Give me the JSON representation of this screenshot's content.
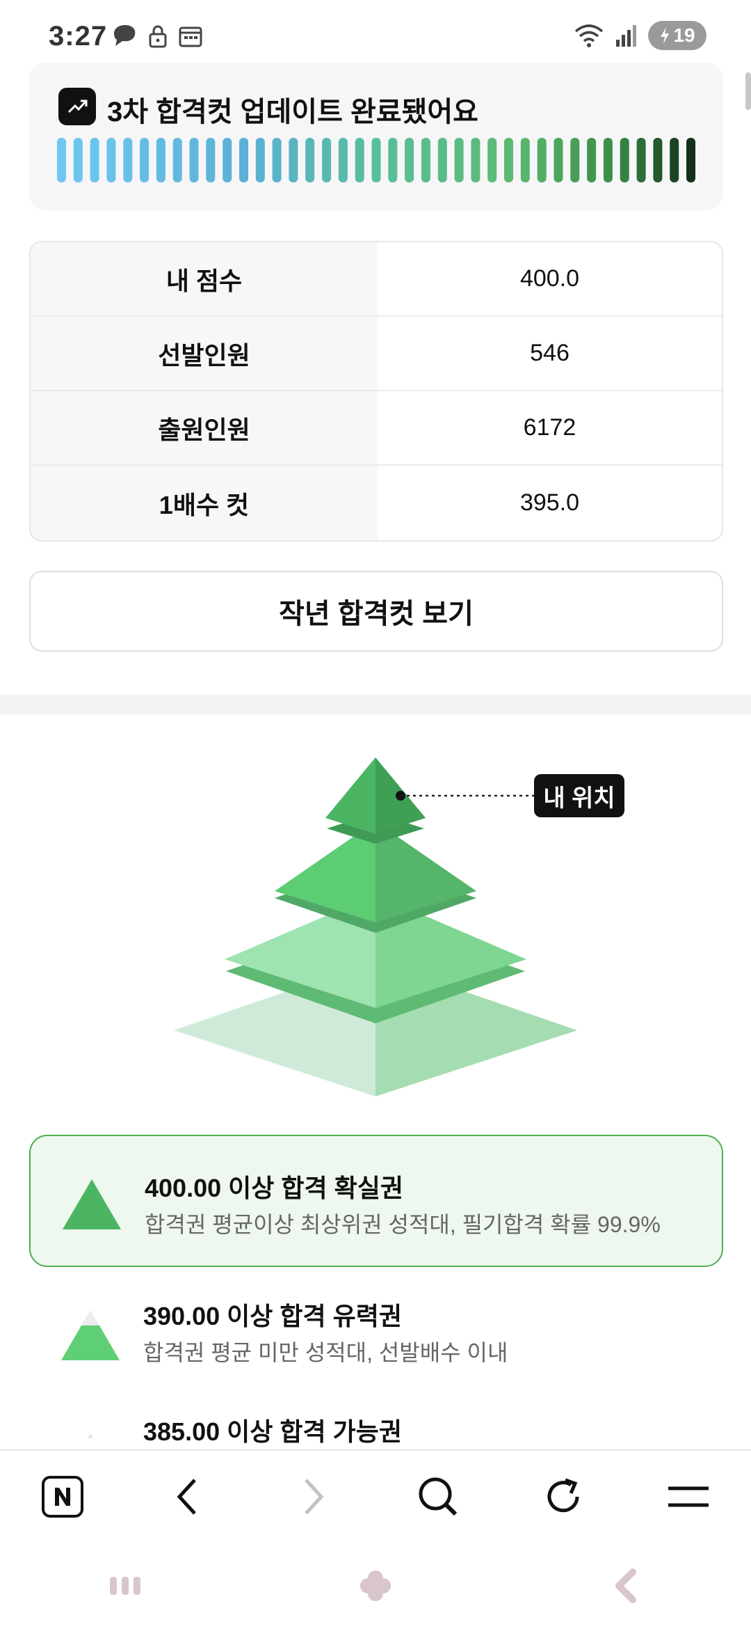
{
  "status_bar": {
    "time": "3:27",
    "battery": "19"
  },
  "update_banner": {
    "title": "3차 합격컷 업데이트 완료됐어요",
    "icon": "trend-up-icon"
  },
  "score_table": {
    "rows": [
      {
        "label": "내 점수",
        "value": "400.0"
      },
      {
        "label": "선발인원",
        "value": "546"
      },
      {
        "label": "출원인원",
        "value": "6172"
      },
      {
        "label": "1배수 컷",
        "value": "395.0"
      }
    ]
  },
  "prev_cut_button": {
    "label": "작년 합격컷 보기"
  },
  "pyramid": {
    "my_position_label": "내 위치",
    "my_level": 1,
    "level_count": 4
  },
  "tiers": [
    {
      "title": "400.00 이상 합격 확실권",
      "desc": "합격권 평균이상 최상위권 성적대, 필기합격 확률 99.9%"
    },
    {
      "title": "390.00 이상 합격 유력권",
      "desc": "합격권 평균 미만 성적대, 선발배수 이내"
    },
    {
      "title": "385.00 이상 합격 가능권",
      "desc": ""
    }
  ],
  "colors": {
    "accent_green": "#4caf50",
    "active_bg": "#eef8ee"
  }
}
